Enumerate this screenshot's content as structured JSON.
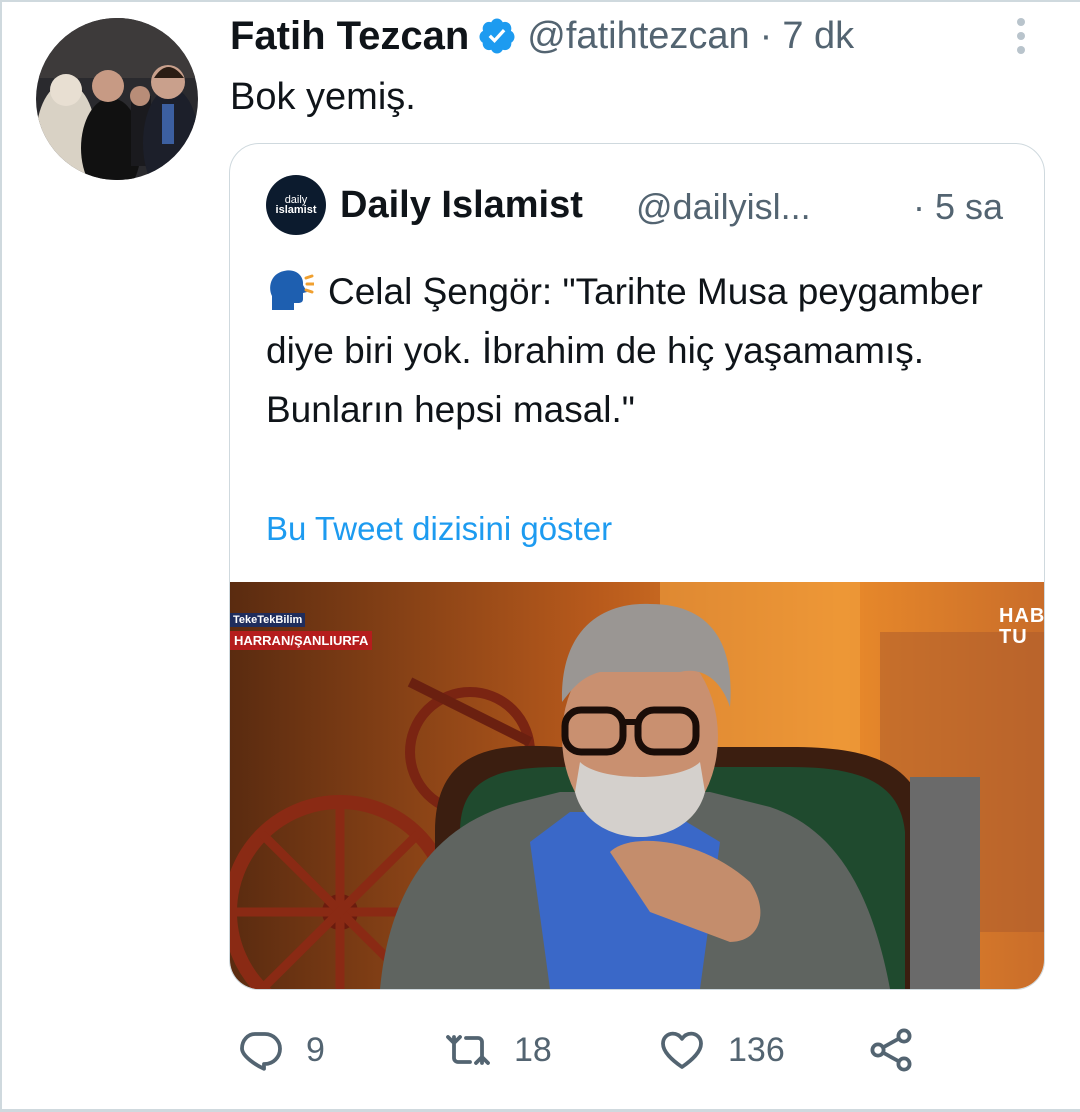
{
  "tweet": {
    "author_name": "Fatih Tezcan",
    "handle": "@fatihtezcan",
    "separator": "·",
    "time": "7 dk",
    "text": "Bok yemiş."
  },
  "quoted_tweet": {
    "author_name": "Daily Islamist",
    "avatar_text_top": "daily",
    "avatar_text_bottom": "islamist",
    "handle": "@dailyisl...",
    "time": "· 5 sa",
    "text": "Celal Şengör: \"Tarihte Musa peygamber diye biri yok. İbrahim de hiç yaşamamış. Bunların hepsi masal.\"",
    "show_thread_link": "Bu Tweet dizisini göster",
    "media": {
      "label_top": "TekeTekBilim",
      "label_location": "HARRAN/ŞANLIURFA",
      "channel_logo_line1": "HAB",
      "channel_logo_line2": "TU"
    }
  },
  "actions": {
    "replies": "9",
    "retweets": "18",
    "likes": "136"
  },
  "colors": {
    "text": "#0f1419",
    "secondary": "#536471",
    "link": "#1d9bf0",
    "verified": "#1d9bf0",
    "border": "#cfd9de"
  }
}
